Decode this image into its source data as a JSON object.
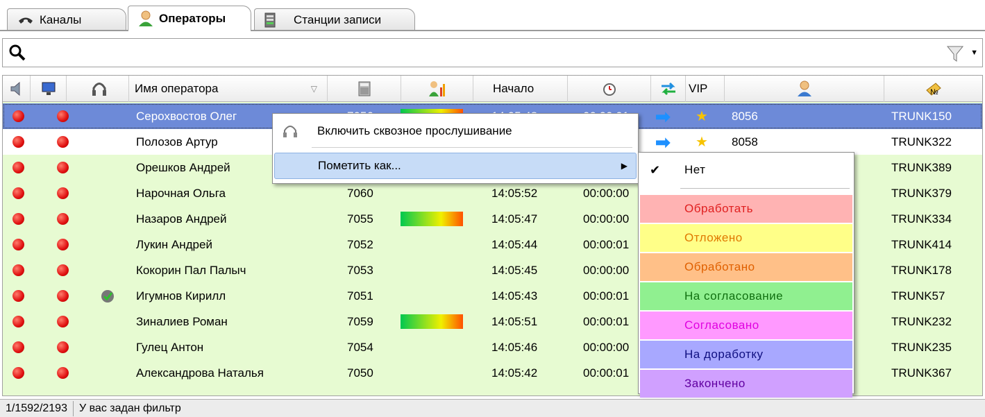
{
  "tabs": [
    {
      "label": "Каналы",
      "icon": "phone-handset-icon"
    },
    {
      "label": "Операторы",
      "icon": "operator-person-icon",
      "active": true
    },
    {
      "label": "Станции записи",
      "icon": "recording-station-icon"
    }
  ],
  "search": {
    "value": ""
  },
  "columns": {
    "name": "Имя оператора",
    "start": "Начало",
    "vip": "VIP"
  },
  "rows": [
    {
      "name": "Серохвостов Олег",
      "ext": "7056",
      "start": "14:05:48",
      "dur": "00:00:01",
      "vip_num": "8056",
      "trunk": "TRUNK150",
      "bar": true,
      "arrow": true,
      "star": true
    },
    {
      "name": "Полозов Артур",
      "ext": "",
      "start": "",
      "dur": "",
      "vip_num": "8058",
      "trunk": "TRUNK322",
      "bar": false,
      "arrow": true,
      "star": true
    },
    {
      "name": "Орешков Андрей",
      "ext": "",
      "start": "",
      "dur": "",
      "vip_num": "",
      "trunk": "TRUNK389",
      "bar": false
    },
    {
      "name": "Нарочная Ольга",
      "ext": "7060",
      "start": "14:05:52",
      "dur": "00:00:00",
      "vip_num": "",
      "trunk": "TRUNK379",
      "bar": false
    },
    {
      "name": "Назаров Андрей",
      "ext": "7055",
      "start": "14:05:47",
      "dur": "00:00:00",
      "vip_num": "",
      "trunk": "TRUNK334",
      "bar": true
    },
    {
      "name": "Лукин Андрей",
      "ext": "7052",
      "start": "14:05:44",
      "dur": "00:00:01",
      "vip_num": "",
      "trunk": "TRUNK414",
      "bar": false
    },
    {
      "name": "Кокорин Пал Палыч",
      "ext": "7053",
      "start": "14:05:45",
      "dur": "00:00:00",
      "vip_num": "",
      "trunk": "TRUNK178",
      "bar": false
    },
    {
      "name": "Игумнов Кирилл",
      "ext": "7051",
      "start": "14:05:43",
      "dur": "00:00:01",
      "vip_num": "",
      "trunk": "TRUNK57",
      "bar": false,
      "listen": true
    },
    {
      "name": "Зиналиев Роман",
      "ext": "7059",
      "start": "14:05:51",
      "dur": "00:00:01",
      "vip_num": "",
      "trunk": "TRUNK232",
      "bar": true
    },
    {
      "name": "Гулец Антон",
      "ext": "7054",
      "start": "14:05:46",
      "dur": "00:00:00",
      "vip_num": "",
      "trunk": "TRUNK235",
      "bar": false
    },
    {
      "name": "Александрова Наталья",
      "ext": "7050",
      "start": "14:05:42",
      "dur": "00:00:01",
      "vip_num": "",
      "trunk": "TRUNK367",
      "bar": false
    }
  ],
  "context_menu": {
    "listen_label": "Включить сквозное прослушивание",
    "mark_label": "Пометить как..."
  },
  "submenu": {
    "items": [
      {
        "label": "Нет",
        "color": "#ffffff",
        "text_color": "#000000",
        "checked": true
      },
      {
        "label": "Обработать",
        "color": "#ffb3b3",
        "text_color": "#e02020"
      },
      {
        "label": "Отложено",
        "color": "#ffff88",
        "text_color": "#e07800"
      },
      {
        "label": "Обработано",
        "color": "#ffc088",
        "text_color": "#e06000"
      },
      {
        "label": "На согласование",
        "color": "#90f090",
        "text_color": "#107010"
      },
      {
        "label": "Согласовано",
        "color": "#ff99ff",
        "text_color": "#e000e0"
      },
      {
        "label": "На доработку",
        "color": "#a8a8ff",
        "text_color": "#101080"
      },
      {
        "label": "Закончено",
        "color": "#d0a0ff",
        "text_color": "#6000a0"
      }
    ]
  },
  "status": {
    "counter": "1/1592/2193",
    "filter_text": "У вас задан фильтр"
  }
}
